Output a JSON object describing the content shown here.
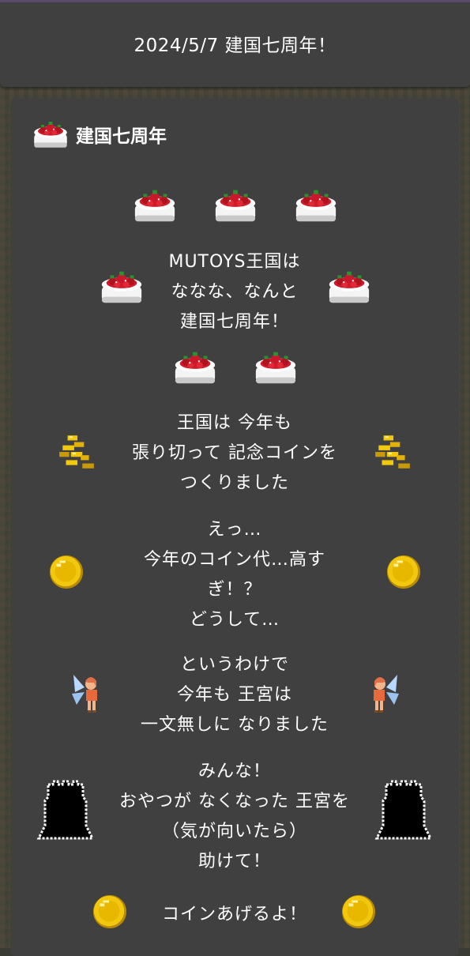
{
  "header": {
    "title": "2024/5/7 建国七周年！"
  },
  "card": {
    "title": "建国七周年",
    "icon": "strawberry-cake-icon",
    "sections": [
      {
        "lines": [
          "MUTOYS王国は",
          "ななな、なんと",
          "建国七周年！"
        ],
        "side_icon": "strawberry-cake-icon"
      },
      {
        "lines": [
          "王国は 今年も",
          "張り切って 記念コインを",
          "つくりました"
        ],
        "side_icon": "coin-pile-icon"
      },
      {
        "lines": [
          "えっ…",
          "今年のコイン代…高す",
          "ぎ！？",
          "どうして…"
        ],
        "side_icon": "gold-coin-icon"
      },
      {
        "lines": [
          "というわけで",
          "今年も 王宮は",
          "一文無しに なりました"
        ],
        "side_icon": "fairy-icon"
      },
      {
        "lines": [
          "みんな！",
          "おやつが なくなった 王宮を",
          "（気が向いたら）",
          "助けて！"
        ],
        "side_icon": "castle-silhouette-icon"
      },
      {
        "lines": [
          "コインあげるよ！"
        ],
        "side_icon": "gold-coin-icon"
      }
    ]
  },
  "colors": {
    "panel": "#404040",
    "text": "#ffffff",
    "cake_red": "#d01c2a",
    "coin_gold": "#f2c80f"
  }
}
